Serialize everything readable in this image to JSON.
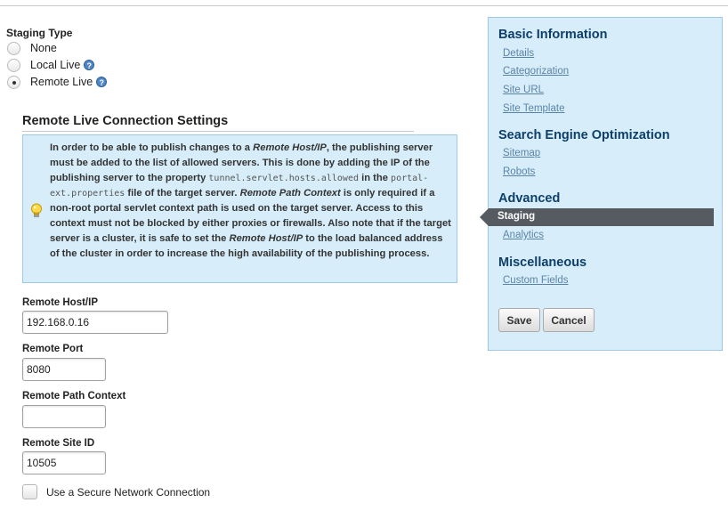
{
  "staging": {
    "label": "Staging Type",
    "options": [
      {
        "label": "None",
        "selected": false,
        "help": false
      },
      {
        "label": "Local Live",
        "selected": false,
        "help": true
      },
      {
        "label": "Remote Live",
        "selected": true,
        "help": true
      }
    ],
    "help_glyph": "?"
  },
  "remote_settings": {
    "title": "Remote Live Connection Settings",
    "info": {
      "icon": "lightbulb-icon",
      "p1": "In order to be able to publish changes to a ",
      "term_host": "Remote Host/IP",
      "p2": ", the publishing server must be added to the list of allowed servers. This is done by adding the IP of the publishing server to the property ",
      "prop": "tunnel.servlet.hosts.allowed",
      "p3": " in the ",
      "file": "portal-ext.properties",
      "p4": " file of the target server. ",
      "term_path": "Remote Path Context",
      "p5": " is only required if a non-root portal servlet context path is used on the target server. Access to this context must not be blocked by either proxies or firewalls. Also note that if the target server is a cluster, it is safe to set the ",
      "term_host2": "Remote Host/IP",
      "p6": " to the load balanced address of the cluster in order to increase the high availability of the publishing process."
    },
    "fields": {
      "host": {
        "label": "Remote Host/IP",
        "value": "192.168.0.16"
      },
      "port": {
        "label": "Remote Port",
        "value": "8080"
      },
      "path": {
        "label": "Remote Path Context",
        "value": ""
      },
      "site_id": {
        "label": "Remote Site ID",
        "value": "10505"
      }
    },
    "secure": {
      "label": "Use a Secure Network Connection",
      "checked": false
    }
  },
  "nav": {
    "basic": {
      "heading": "Basic Information",
      "items": [
        "Details",
        "Categorization",
        "Site URL",
        "Site Template"
      ]
    },
    "seo": {
      "heading": "Search Engine Optimization",
      "items": [
        "Sitemap",
        "Robots"
      ]
    },
    "advanced": {
      "heading": "Advanced",
      "active": "Staging",
      "items": [
        "Analytics"
      ]
    },
    "misc": {
      "heading": "Miscellaneous",
      "items": [
        "Custom Fields"
      ]
    },
    "buttons": {
      "save": "Save",
      "cancel": "Cancel"
    }
  },
  "colors": {
    "panel_bg": "#d7eefa",
    "panel_border": "#9fc9e3",
    "heading": "#0e3f6b",
    "link": "#5b83a6",
    "active_bg": "#555b60"
  }
}
